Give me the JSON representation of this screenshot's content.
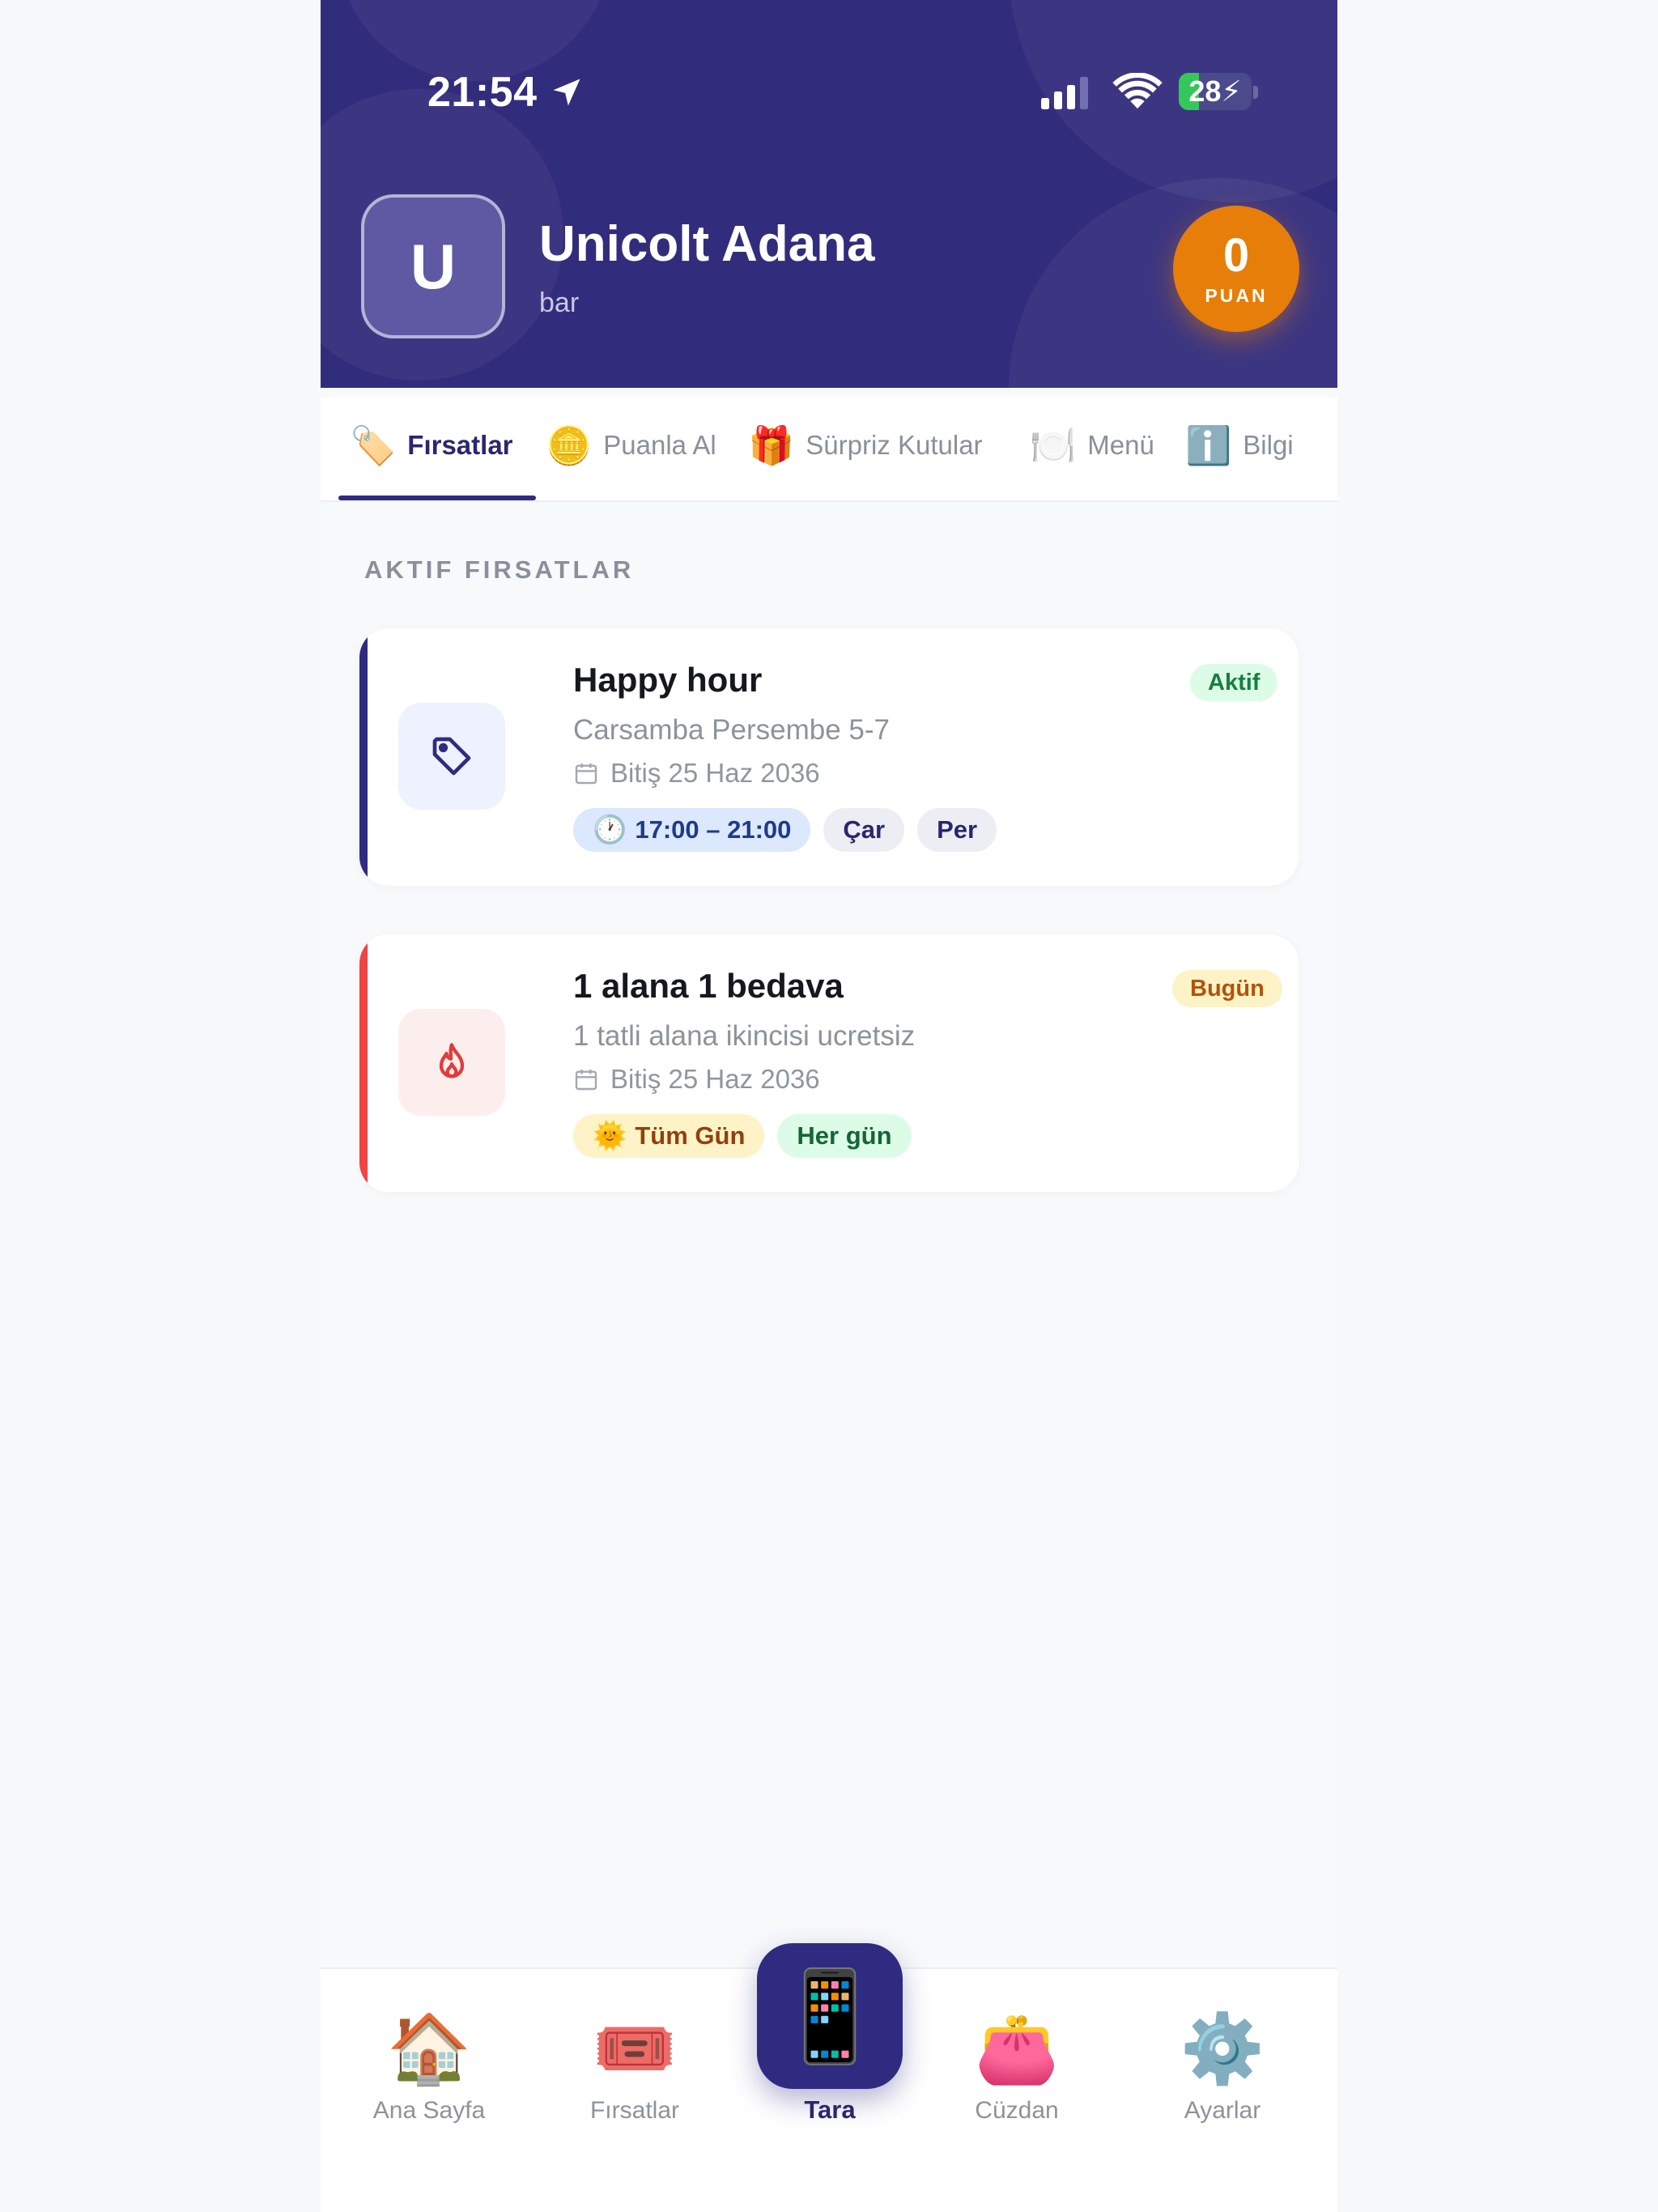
{
  "status_bar": {
    "time": "21:54",
    "battery": "28",
    "battery_level": 0.28
  },
  "venue": {
    "initial": "U",
    "name": "Unicolt Adana",
    "type": "bar",
    "points_value": "0",
    "points_label": "PUAN"
  },
  "tabs": [
    {
      "label": "Fırsatlar",
      "icon": "price-tag-icon",
      "active": true
    },
    {
      "label": "Puanla Al",
      "icon": "coin-icon",
      "active": false
    },
    {
      "label": "Sürpriz Kutular",
      "icon": "gift-icon",
      "active": false
    },
    {
      "label": "Menü",
      "icon": "plate-icon",
      "active": false
    },
    {
      "label": "Bilgi",
      "icon": "info-icon",
      "active": false
    }
  ],
  "section_title": "AKTIF FIRSATLAR",
  "deals": [
    {
      "title": "Happy hour",
      "description": "Carsamba Persembe 5-7",
      "expiry": "Bitiş 25 Haz 2036",
      "badge": "Aktif",
      "icon": "tag-icon",
      "accent_color": "#2f2b80",
      "time_chip": "17:00 – 21:00",
      "day_chips": [
        "Çar",
        "Per"
      ]
    },
    {
      "title": "1 alana 1 bedava",
      "description": "1 tatli alana ikincisi ucretsiz",
      "expiry": "Bitiş 25 Haz 2036",
      "badge": "Bugün",
      "icon": "flame-icon",
      "accent_color": "#ef4444",
      "time_chip": "Tüm Gün",
      "day_chips": [
        "Her gün"
      ]
    }
  ],
  "bottom_nav": {
    "items": [
      {
        "label": "Ana Sayfa",
        "icon": "house-icon"
      },
      {
        "label": "Fırsatlar",
        "icon": "ticket-icon"
      },
      {
        "label": "Tara",
        "icon": "phone-icon",
        "active": true
      },
      {
        "label": "Cüzdan",
        "icon": "purse-icon"
      },
      {
        "label": "Ayarlar",
        "icon": "gear-icon"
      }
    ]
  },
  "colors": {
    "brand": "#322c7c",
    "points": "#e67e09",
    "active_badge_bg": "#dcfce7",
    "active_badge_text": "#15803d",
    "today_badge_bg": "#fef3c7",
    "today_badge_text": "#b45309"
  }
}
